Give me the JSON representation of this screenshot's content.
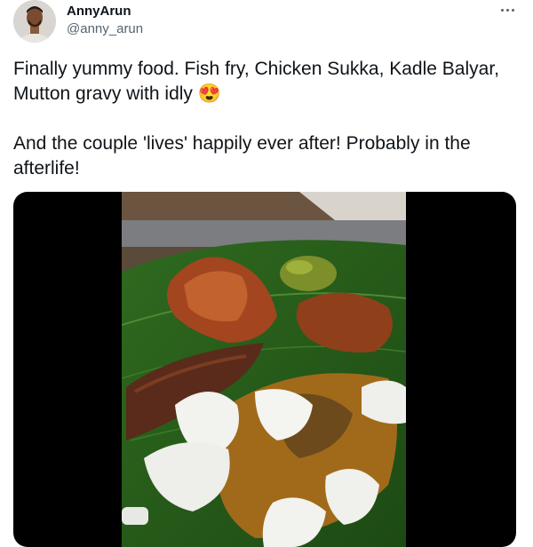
{
  "tweet": {
    "author_name": "AnnyArun",
    "author_handle": "@anny_arun",
    "text_line1": "Finally yummy food. Fish fry, Chicken Sukka, Kadle Balyar, Mutton gravy with idly",
    "emoji": "😍",
    "text_line2": "And the couple 'lives' happily ever after! Probably in the afterlife!"
  },
  "icons": {
    "more": "more-horizontal-icon",
    "emoji": "heart-eyes-emoji"
  },
  "colors": {
    "text": "#0f1419",
    "secondary": "#536471",
    "media_bg": "#000000"
  }
}
